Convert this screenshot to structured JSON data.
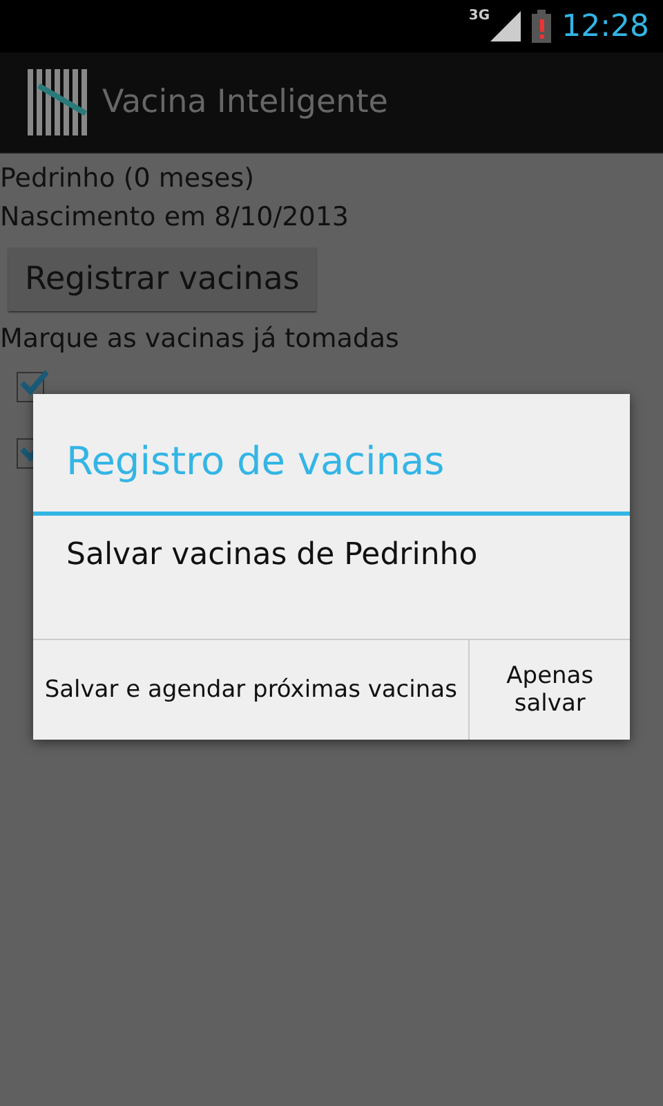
{
  "status_bar": {
    "network": "3G",
    "time": "12:28"
  },
  "action_bar": {
    "title": "Vacina Inteligente"
  },
  "child": {
    "name": "Pedrinho (0 meses)",
    "birth": "Nascimento em 8/10/2013"
  },
  "register_button": "Registrar vacinas",
  "instructions": "Marque as vacinas já tomadas",
  "vaccines": [
    {
      "checked": true
    },
    {
      "checked": true
    }
  ],
  "dialog": {
    "title": "Registro de vacinas",
    "message": "Salvar vacinas de Pedrinho",
    "buttons": [
      "Salvar e agendar próximas vacinas",
      "Apenas salvar"
    ]
  }
}
